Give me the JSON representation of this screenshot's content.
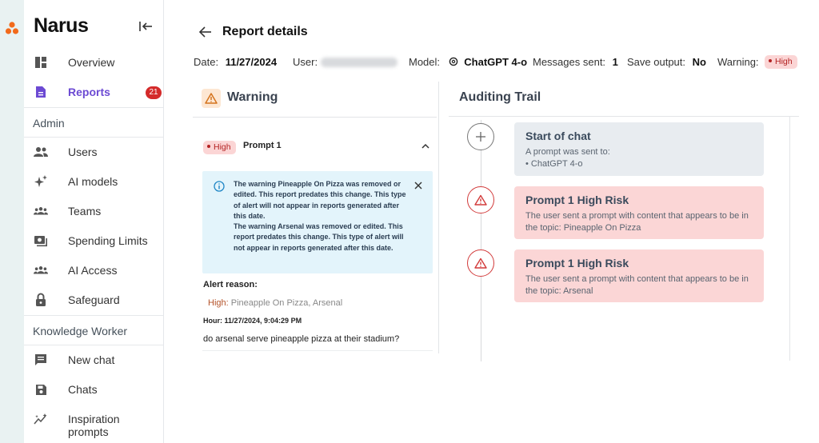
{
  "app": {
    "name": "Narus"
  },
  "sidebar": {
    "items": [
      {
        "label": "Overview",
        "icon": "dashboard-icon"
      },
      {
        "label": "Reports",
        "icon": "report-icon",
        "badge": "21",
        "active": true
      }
    ],
    "admin_label": "Admin",
    "admin_items": [
      {
        "label": "Users",
        "icon": "users-icon"
      },
      {
        "label": "AI models",
        "icon": "sparkle-icon"
      },
      {
        "label": "Teams",
        "icon": "teams-icon"
      },
      {
        "label": "Spending Limits",
        "icon": "spending-icon"
      },
      {
        "label": "AI Access",
        "icon": "access-icon"
      },
      {
        "label": "Safeguard",
        "icon": "lock-icon"
      }
    ],
    "kw_label": "Knowledge Worker",
    "kw_items": [
      {
        "label": "New chat",
        "icon": "chat-icon"
      },
      {
        "label": "Chats",
        "icon": "save-icon"
      },
      {
        "label": "Inspiration prompts",
        "icon": "inspiration-icon"
      }
    ]
  },
  "header": {
    "title": "Report details",
    "date_label": "Date:",
    "date_value": "11/27/2024",
    "user_label": "User:",
    "model_label": "Model:",
    "model_value": "ChatGPT 4-o",
    "messages_label": "Messages sent:",
    "messages_value": "1",
    "save_label": "Save output:",
    "save_value": "No",
    "warning_label": "Warning:",
    "warning_value": "High"
  },
  "warning_panel": {
    "title": "Warning",
    "prompt": {
      "severity": "High",
      "title": "Prompt 1"
    },
    "info_text": "The warning Pineapple On Pizza was removed or edited. This report predates this change. This type of alert will not appear in reports generated after this date.",
    "info_text2": "The warning Arsenal was removed or edited. This report predates this change. This type of alert will not appear in reports generated after this date.",
    "alert_reason_label": "Alert reason:",
    "alert_reason_level": "High:",
    "alert_reason_topics": "Pineapple On Pizza, Arsenal",
    "hour": "Hour: 11/27/2024, 9:04:29 PM",
    "message": "do arsenal serve pineapple pizza at their stadium?"
  },
  "audit": {
    "title": "Auditing Trail",
    "events": [
      {
        "title": "Start of chat",
        "line1": "A prompt was sent to:",
        "line2": "• ChatGPT 4-o",
        "type": "neutral"
      },
      {
        "title": "Prompt 1 High Risk",
        "line1": "The user sent a prompt with content that appears to be in the topic: Pineapple On Pizza",
        "type": "risk"
      },
      {
        "title": "Prompt 1 High Risk",
        "line1": "The user sent a prompt with content that appears to be in the topic: Arsenal",
        "type": "risk"
      }
    ]
  },
  "colors": {
    "accent": "#6c4ad3",
    "danger": "#d23a3a",
    "info_bg": "#e3f4fb",
    "risk_bg": "#fbd6d6"
  }
}
